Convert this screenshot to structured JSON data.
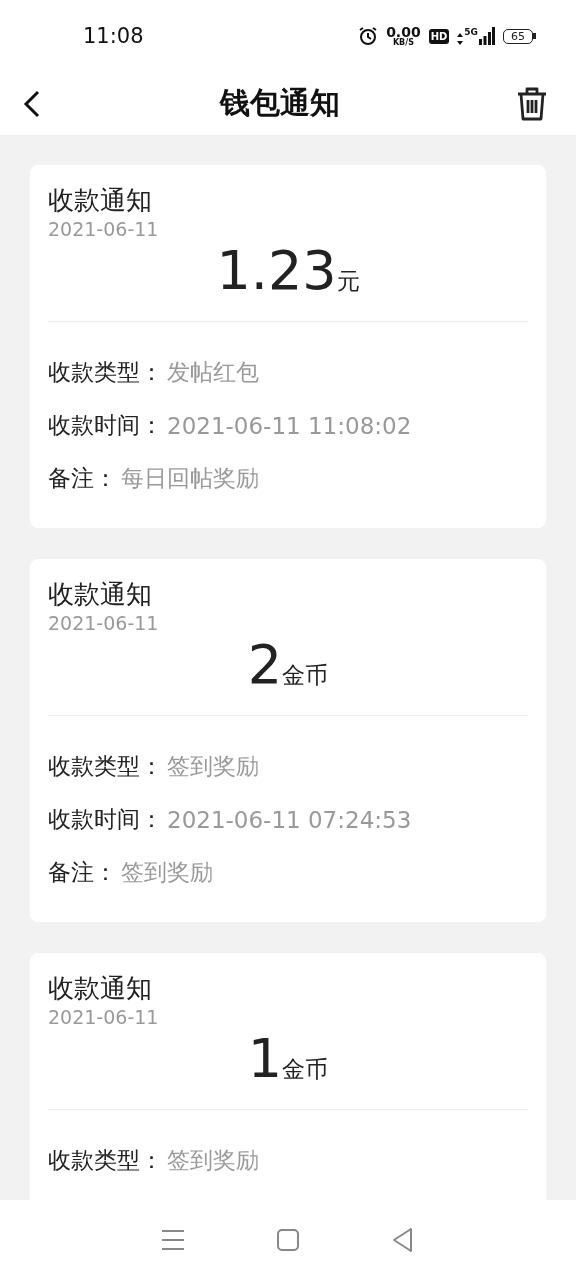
{
  "status_bar": {
    "time": "11:08",
    "net_speed": "0.00",
    "net_unit": "KB/S",
    "hd": "HD",
    "network": "5G",
    "battery": "65"
  },
  "header": {
    "title": "钱包通知"
  },
  "notices": [
    {
      "title": "收款通知",
      "date": "2021-06-11",
      "amount": "1.23",
      "unit": "元",
      "rows": [
        {
          "label": "收款类型：",
          "value": "发帖红包"
        },
        {
          "label": "收款时间：",
          "value": "2021-06-11 11:08:02"
        },
        {
          "label": "备注：",
          "value": "每日回帖奖励"
        }
      ]
    },
    {
      "title": "收款通知",
      "date": "2021-06-11",
      "amount": "2",
      "unit": "金币",
      "rows": [
        {
          "label": "收款类型：",
          "value": "签到奖励"
        },
        {
          "label": "收款时间：",
          "value": "2021-06-11 07:24:53"
        },
        {
          "label": "备注：",
          "value": "签到奖励"
        }
      ]
    },
    {
      "title": "收款通知",
      "date": "2021-06-11",
      "amount": "1",
      "unit": "金币",
      "rows": [
        {
          "label": "收款类型：",
          "value": "签到奖励"
        }
      ]
    }
  ]
}
